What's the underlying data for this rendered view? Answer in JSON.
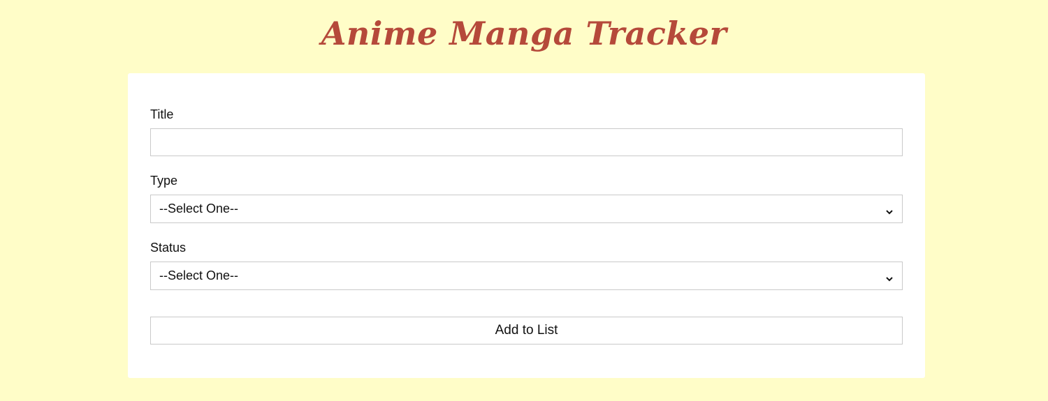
{
  "header": {
    "title": "Anime Manga Tracker"
  },
  "form": {
    "title_label": "Title",
    "title_value": "",
    "type_label": "Type",
    "type_selected": "--Select One--",
    "status_label": "Status",
    "status_selected": "--Select One--",
    "submit_label": "Add to List"
  },
  "colors": {
    "background": "#fffdc8",
    "title": "#b5493a",
    "card": "#ffffff",
    "border": "#c9c9c9"
  },
  "icons": {
    "select_arrow": "chevron-down-icon"
  }
}
